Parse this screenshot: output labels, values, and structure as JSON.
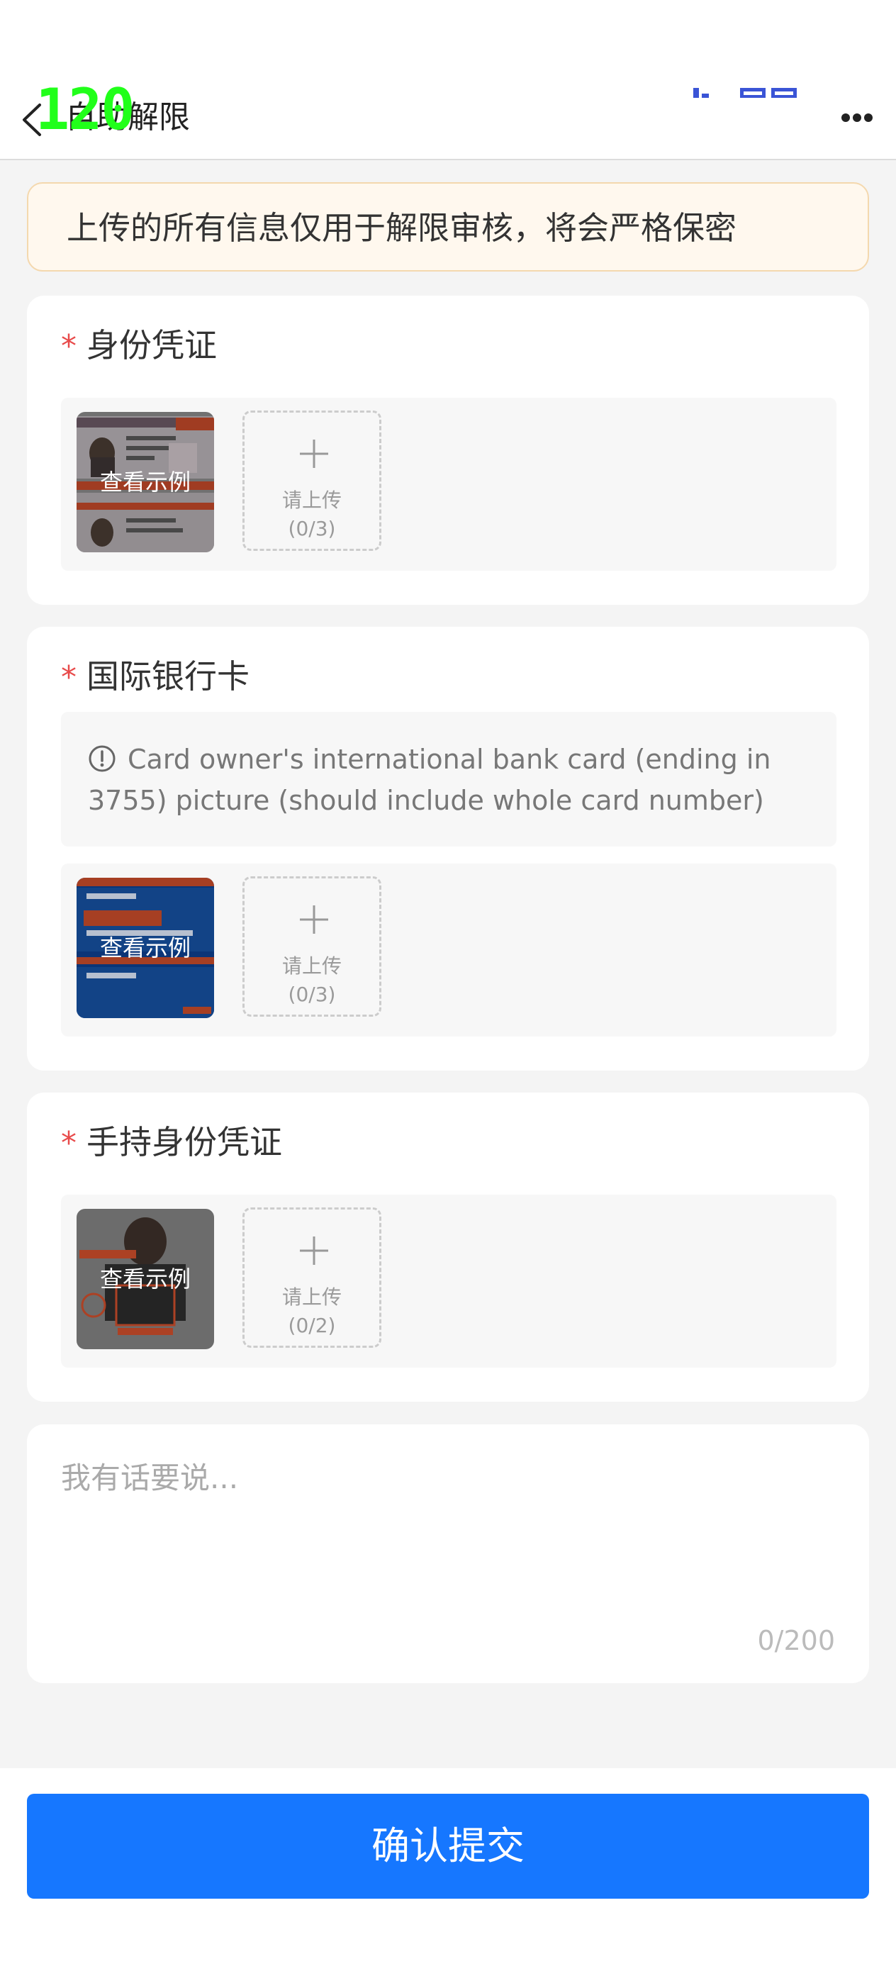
{
  "header": {
    "title": "自助解限",
    "overlay_number": "120",
    "back_icon": "chevron-left-icon",
    "more_icon": "more-horizontal-icon"
  },
  "notice": {
    "text": "上传的所有信息仅用于解限审核，将会严格保密"
  },
  "sections": [
    {
      "required_mark": "*",
      "title": "身份凭证",
      "sample_label": "查看示例",
      "upload_label": "请上传",
      "upload_count": "(0/3)"
    },
    {
      "required_mark": "*",
      "title": "国际银行卡",
      "tip": "Card owner's international bank card (ending in 3755) picture (should include whole card number)",
      "sample_label": "查看示例",
      "upload_label": "请上传",
      "upload_count": "(0/3)"
    },
    {
      "required_mark": "*",
      "title": "手持身份凭证",
      "sample_label": "查看示例",
      "upload_label": "请上传",
      "upload_count": "(0/2)"
    }
  ],
  "comment": {
    "placeholder": "我有话要说...",
    "value": "",
    "counter": "0/200"
  },
  "submit": {
    "label": "确认提交"
  },
  "colors": {
    "primary": "#1677ff",
    "required": "#e84a4a",
    "notice_bg": "#fff8ee",
    "overlay_green": "#21ff1a"
  }
}
